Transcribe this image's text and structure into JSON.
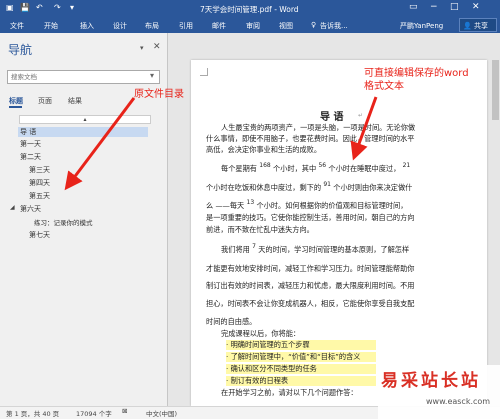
{
  "window": {
    "title": "7天学会时间管理.pdf - Word",
    "user": "严鹏YanPeng",
    "share_label": "共享",
    "ribbon_tabs": [
      "文件",
      "开始",
      "插入",
      "设计",
      "布局",
      "引用",
      "邮件",
      "审阅",
      "视图",
      "告诉我..."
    ]
  },
  "nav": {
    "title": "导航",
    "search_placeholder": "搜索文档",
    "tabs": [
      "标题",
      "页面",
      "结果"
    ],
    "headings": [
      "导 语",
      "第一天",
      "第二天",
      "第三天",
      "第四天",
      "第五天",
      "第六天",
      "练习：记录你的模式",
      "第七天"
    ]
  },
  "document": {
    "heading": "导 语",
    "lines": [
      "人生最宝贵的两项资产，一项是头脑，一项是时间。无论你做",
      "什么事情，即使不用脑子，也要花费时间。因此，管理时间的水平",
      "高低，会决定你事业和生活的成败。",
      "每个星期有",
      "168",
      "个小时，其中",
      "56",
      "个小时在睡眠中度过，",
      "21",
      "个小时在吃饭和休息中度过，剩下的",
      "91",
      "个小时则由你来决定做什",
      "么 ——每天",
      "13",
      "个小时。如何根据你的价值观和目标管理时间，",
      "是一项重要的技巧。它使你能控制生活，善用时间，朝自己的方向",
      "前进，而不致在忙乱中迷失方向。",
      "我们将用",
      "7",
      "天的时间，学习时间管理的基本原则，了解怎样",
      "才能更有效地安排时间，减轻工作和学习压力。时间管理能帮助你",
      "制订出有效的时间表，减轻压力和忧虑，最大限度利用时间。不用",
      "担心，时间表不会让你变成机器人，相反，它能使你享受自我支配",
      "时间的自由感。",
      "完成课程以后，你将能：",
      "· 明确时间管理的五个步骤",
      "· 了解时间管理中，“价值”和“目标”的含义",
      "· 确认和区分不同类型的任务",
      "· 制订有效的日程表",
      "在开始学习之前，请对以下几个问题作答："
    ]
  },
  "annotations": {
    "left": "原文件目录",
    "right_line1": "可直接编辑保存的word",
    "right_line2": "格式文本"
  },
  "status": {
    "page": "第 1 页，共 40 页",
    "words": "17094 个字",
    "lang": "中文(中国)"
  },
  "watermark": {
    "text": "易采站长站",
    "url": "www.easck.com"
  },
  "colors": {
    "word_blue": "#2b579a",
    "annotation_red": "#e8231a",
    "highlight_yellow": "#fff9a8"
  }
}
